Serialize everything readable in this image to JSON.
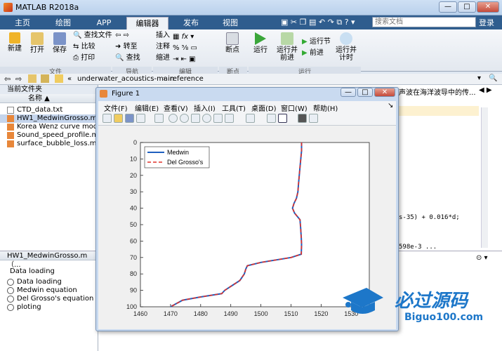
{
  "app": {
    "title": "MATLAB R2018a",
    "win_min": "—",
    "win_max": "□",
    "win_close": "✕",
    "help_q": "?",
    "tab_arrow": "▾"
  },
  "tabs": [
    "主页",
    "绘图",
    "APP",
    "编辑器",
    "发布",
    "视图"
  ],
  "search_placeholder": "搜索文档",
  "login": "登录",
  "ribbon": {
    "file_btns": [
      "新建",
      "打开",
      "保存"
    ],
    "file_small": [
      "查找文件",
      "比较",
      "打印"
    ],
    "nav_small": [
      "转至",
      "查找"
    ],
    "edit_small": [
      "插入",
      "注释",
      "缩进"
    ],
    "bp": "断点",
    "run": "运行",
    "run_adv": "运行并\n前进",
    "run_sec": "运行节",
    "advance": "前进",
    "run_time": "运行并\n计时",
    "groups": [
      "文件",
      "导航",
      "编辑",
      "断点",
      "运行"
    ]
  },
  "address": {
    "parts": [
      "«",
      "underwater_acoustics-main",
      "›",
      "reference"
    ]
  },
  "current_folder": {
    "title": "当前文件夹",
    "col": "名称 ▲",
    "files": [
      "CTD_data.txt",
      "HW1_MedwinGrosso.m",
      "Korea Wenz curve mod",
      "Sound_speed_profile.m",
      "surface_bubble_loss.m"
    ],
    "selected": 1
  },
  "details": {
    "title": "HW1_MedwinGrosso.m （...",
    "heading": "Data loading",
    "items": [
      "Data loading",
      "Medwin equation",
      "Del Grosso's equation",
      "ploting"
    ]
  },
  "editor": {
    "tab_text": "声波在海洋波导中的传...",
    "code1": "s-35) + 0.016*d;",
    "code2": "598e-3 ..."
  },
  "figure": {
    "title": "Figure 1",
    "menu": [
      "文件(F)",
      "编辑(E)",
      "查看(V)",
      "插入(I)",
      "工具(T)",
      "桌面(D)",
      "窗口(W)",
      "帮助(H)"
    ]
  },
  "chart_data": {
    "type": "line",
    "x_ticks": [
      1460,
      1470,
      1480,
      1490,
      1500,
      1510,
      1520,
      1530
    ],
    "y_ticks": [
      0,
      10,
      20,
      30,
      40,
      50,
      60,
      70,
      80,
      90,
      100
    ],
    "xlim": [
      1460,
      1536
    ],
    "ylim": [
      0,
      100
    ],
    "y_reversed": true,
    "series": [
      {
        "name": "Medwin",
        "color": "#1f5fbf",
        "style": "solid"
      },
      {
        "name": "Del Grosso's",
        "color": "#e0302a",
        "style": "dashed"
      }
    ],
    "x": [
      1513.5,
      1513.5,
      1513,
      1512.5,
      1512.3,
      1511.8,
      1511,
      1510.5,
      1511.2,
      1513,
      1513.2,
      1513.4,
      1513.5,
      1513.4,
      1510,
      1500,
      1495.5,
      1495,
      1494.5,
      1493,
      1490.5,
      1488,
      1487,
      1480,
      1474,
      1472,
      1470
    ],
    "y": [
      0,
      5,
      15,
      25,
      30,
      34,
      37,
      40,
      43,
      47,
      52,
      58,
      62,
      68,
      70,
      73,
      75,
      77,
      80,
      84,
      87,
      90,
      92,
      94,
      96,
      98,
      100
    ]
  },
  "watermark": {
    "main": "必过源码",
    "sub": "Biguo100.com"
  }
}
